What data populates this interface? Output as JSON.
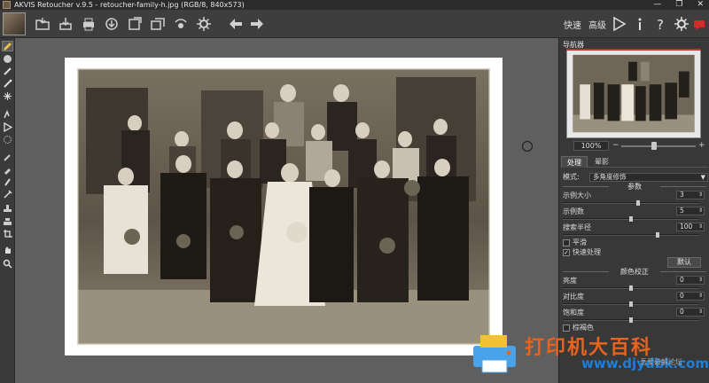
{
  "window": {
    "title": "AKVIS Retoucher v.9.5 - retoucher-family-h.jpg (RGB/8, 840x573)",
    "controls": [
      "—",
      "❐",
      "✕"
    ]
  },
  "toolbar": {
    "mode_express": "快速",
    "mode_advanced": "高级",
    "buttons": [
      "open-icon",
      "save-icon",
      "print-icon",
      "import-icon",
      "export-icon",
      "batch-icon",
      "share-icon",
      "settings-gear-icon",
      "undo-arrow-icon",
      "redo-arrow-icon"
    ],
    "right_buttons": [
      "run-icon",
      "info-icon",
      "help-icon",
      "preferences-icon",
      "feedback-icon"
    ]
  },
  "tools": [
    "brush-icon",
    "eraser-icon",
    "pen-icon",
    "magic-wand-icon",
    "lasso-icon",
    "select-icon",
    "tube-icon",
    "clone-icon",
    "healing-icon",
    "chisel-icon",
    "blur-icon",
    "eyedropper-icon",
    "stamp-icon",
    "crop-icon",
    "hand-icon",
    "zoom-icon"
  ],
  "navigator": {
    "title": "导航器",
    "zoom": "100%",
    "minus": "−",
    "plus": "+"
  },
  "tabs": [
    "处理",
    "晕影"
  ],
  "settings": {
    "mode_label": "模式:",
    "mode_value": "多角度修饰",
    "params_header": "参数",
    "params": [
      {
        "label": "示例大小",
        "value": "3",
        "frac": 0.55
      },
      {
        "label": "示例数",
        "value": "5",
        "frac": 0.5
      },
      {
        "label": "搜索半径",
        "value": "100",
        "frac": 0.7
      }
    ],
    "checkboxes": [
      {
        "label": "平滑",
        "checked": false
      },
      {
        "label": "快速处理",
        "checked": true
      }
    ],
    "default_button": "默认",
    "color_header": "颜色校正",
    "color": [
      {
        "label": "亮度",
        "value": "0",
        "frac": 0.5
      },
      {
        "label": "对比度",
        "value": "0",
        "frac": 0.5
      },
      {
        "label": "饱和度",
        "value": "0",
        "frac": 0.5
      }
    ],
    "sepia_label": "棕褐色"
  },
  "watermark": {
    "title": "打印机大百科",
    "url": "www.djydbk.com",
    "small": "吾爱破解论坛"
  },
  "colors": {
    "accent_red": "#c0392b",
    "wm_orange": "#e8641e",
    "wm_blue": "#1e7fd8"
  }
}
